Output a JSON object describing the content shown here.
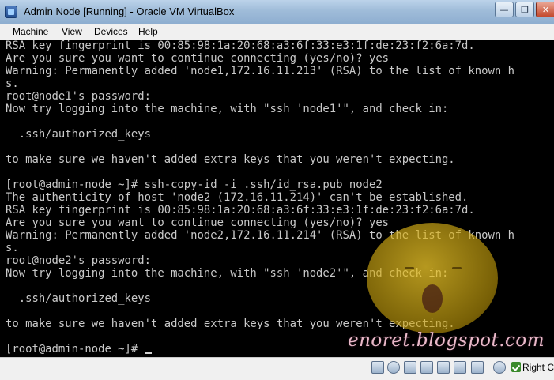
{
  "window": {
    "title": "Admin Node [Running] - Oracle VM VirtualBox",
    "minimize_label": "—",
    "maximize_label": "❐",
    "close_label": "✕"
  },
  "menu": {
    "items": [
      "Machine",
      "View",
      "Devices",
      "Help"
    ]
  },
  "terminal": {
    "lines": [
      "RSA key fingerprint is 00:85:98:1a:20:68:a3:6f:33:e3:1f:de:23:f2:6a:7d.",
      "Are you sure you want to continue connecting (yes/no)? yes",
      "Warning: Permanently added 'node1,172.16.11.213' (RSA) to the list of known h",
      "s.",
      "root@node1's password:",
      "Now try logging into the machine, with \"ssh 'node1'\", and check in:",
      "",
      "  .ssh/authorized_keys",
      "",
      "to make sure we haven't added extra keys that you weren't expecting.",
      "",
      "[root@admin-node ~]# ssh-copy-id -i .ssh/id_rsa.pub node2",
      "The authenticity of host 'node2 (172.16.11.214)' can't be established.",
      "RSA key fingerprint is 00:85:98:1a:20:68:a3:6f:33:e3:1f:de:23:f2:6a:7d.",
      "Are you sure you want to continue connecting (yes/no)? yes",
      "Warning: Permanently added 'node2,172.16.11.214' (RSA) to the list of known h",
      "s.",
      "root@node2's password:",
      "Now try logging into the machine, with \"ssh 'node2'\", and check in:",
      "",
      "  .ssh/authorized_keys",
      "",
      "to make sure we haven't added extra keys that you weren't expecting.",
      "",
      "[root@admin-node ~]# "
    ]
  },
  "watermark": {
    "text": "enoret.blogspot.com"
  },
  "statusbar": {
    "icons": [
      "hard-disk-icon",
      "optical-drive-icon",
      "usb-icon",
      "shared-folders-icon",
      "network-icon",
      "display-icon",
      "video-capture-icon",
      "mouse-integration-icon",
      "host-key-icon"
    ],
    "host_key_label": "Right Ctrl"
  }
}
